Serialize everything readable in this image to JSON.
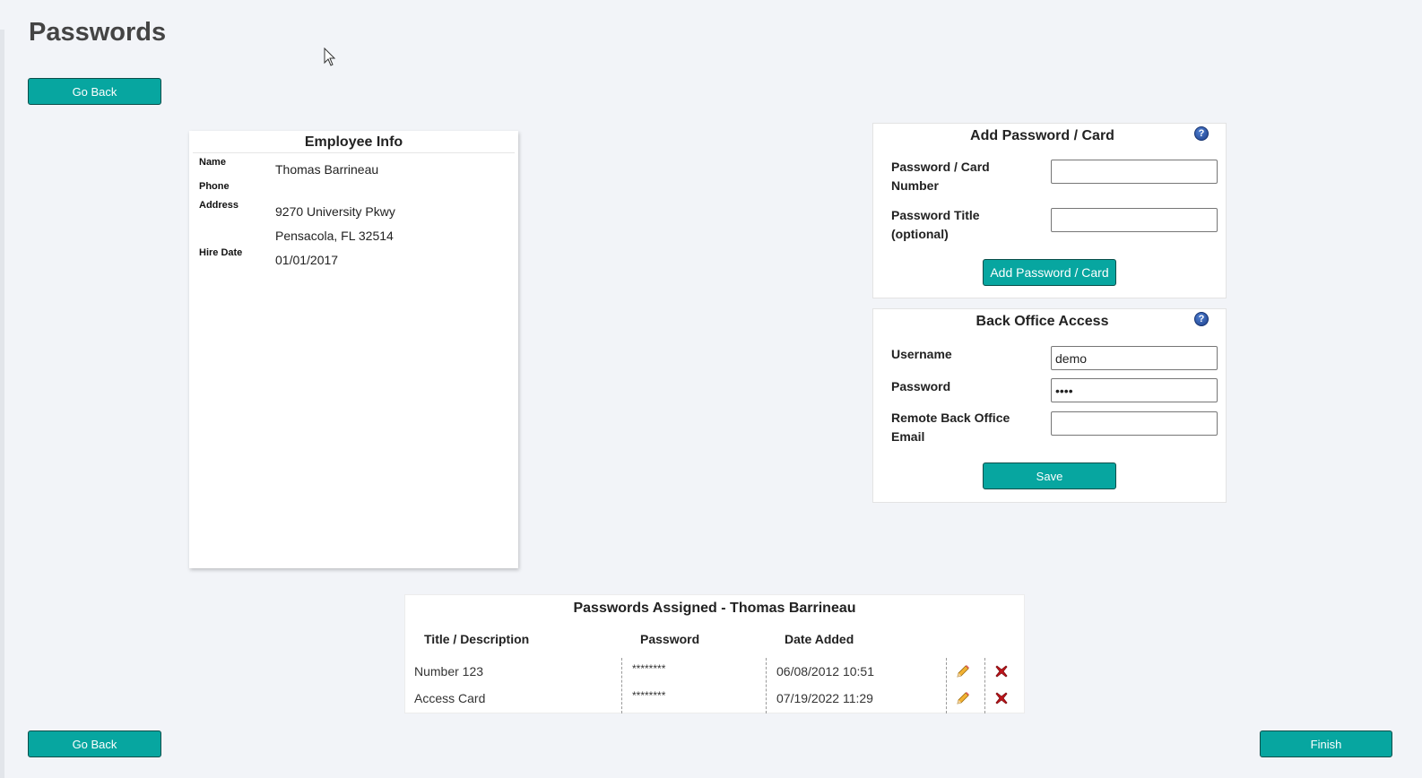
{
  "page": {
    "title": "Passwords"
  },
  "nav": {
    "go_back_label": "Go Back",
    "finish_label": "Finish"
  },
  "employee_info": {
    "title": "Employee Info",
    "name_label": "Name",
    "name": "Thomas Barrineau",
    "phone_label": "Phone",
    "phone": "",
    "address_label": "Address",
    "address_line1": "9270 University Pkwy",
    "address_line2": "Pensacola, FL 32514",
    "hire_date_label": "Hire Date",
    "hire_date": "01/01/2017"
  },
  "add_password": {
    "title": "Add Password / Card",
    "number_label_line1": "Password / Card",
    "number_label_line2": "Number",
    "number_value": "",
    "title_label_line1": "Password Title",
    "title_label_line2": "(optional)",
    "title_value": "",
    "button_label": "Add Password / Card",
    "help_icon": "question-mark-icon"
  },
  "back_office": {
    "title": "Back Office Access",
    "username_label": "Username",
    "username_value": "demo",
    "password_label": "Password",
    "password_value": "demo",
    "remote_label_line1": "Remote Back Office",
    "remote_label_line2": "Email",
    "remote_value": "",
    "save_label": "Save",
    "help_icon": "question-mark-icon"
  },
  "assigned": {
    "title": "Passwords Assigned - Thomas Barrineau",
    "columns": [
      "Title / Description",
      "Password",
      "Date Added"
    ],
    "rows": [
      {
        "title": "Number 123",
        "password": "********",
        "date_added": "06/08/2012 10:51"
      },
      {
        "title": "Access Card",
        "password": "********",
        "date_added": "07/19/2022 11:29"
      }
    ],
    "edit_icon": "pencil-icon",
    "delete_icon": "red-x-icon"
  },
  "colors": {
    "accent": "#07a6a0",
    "background": "#f2f4f8",
    "delete": "#c0141a",
    "help": "#1d3f8a"
  }
}
